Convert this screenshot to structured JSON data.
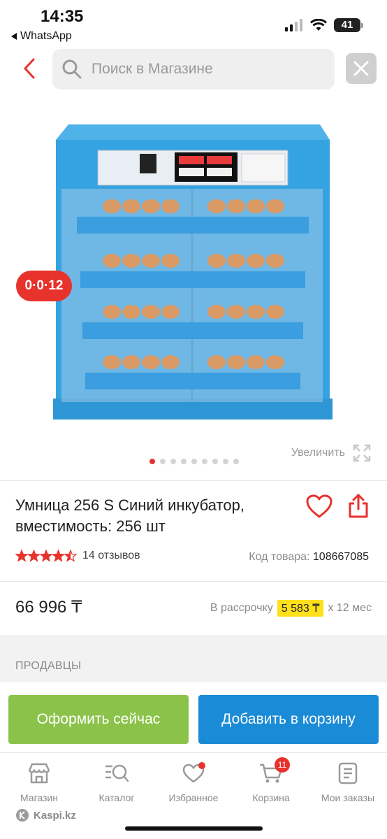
{
  "status_bar": {
    "time": "14:35",
    "back_app": "WhatsApp",
    "battery": "41",
    "icons": [
      "signal-icon",
      "wifi-icon",
      "battery-icon"
    ]
  },
  "search": {
    "placeholder": "Поиск в Магазине"
  },
  "product_image": {
    "timer": "0·0·12",
    "zoom_label": "Увеличить",
    "dots_total": 9,
    "dots_active": 1
  },
  "product": {
    "title": "Умница 256 S Синий инкубатор, вместимость: 256 шт",
    "rating_stars": 4.5,
    "reviews": "14 отзывов",
    "sku_label": "Код товара:",
    "sku_value": "108667085",
    "price": "66 996 ₸",
    "installment_label": "В рассрочку",
    "installment_amount": "5 583 ₸",
    "installment_term": "х 12 мес"
  },
  "sellers": {
    "heading": "ПРОДАВЦЫ"
  },
  "actions": {
    "buy_now": "Оформить сейчас",
    "add_to_cart": "Добавить в корзину"
  },
  "tabbar": {
    "items": [
      {
        "label": "Магазин",
        "icon": "shop-icon"
      },
      {
        "label": "Каталог",
        "icon": "catalog-icon"
      },
      {
        "label": "Избранное",
        "icon": "heart-icon"
      },
      {
        "label": "Корзина",
        "icon": "cart-icon"
      },
      {
        "label": "Мои заказы",
        "icon": "orders-icon"
      }
    ],
    "cart_count": "11"
  },
  "footer": {
    "brand": "Kaspi.kz"
  },
  "colors": {
    "accent_red": "#e8322c",
    "buy_green": "#8bc34a",
    "cart_blue": "#1a8bd6",
    "installment_yellow": "#ffe01b"
  }
}
